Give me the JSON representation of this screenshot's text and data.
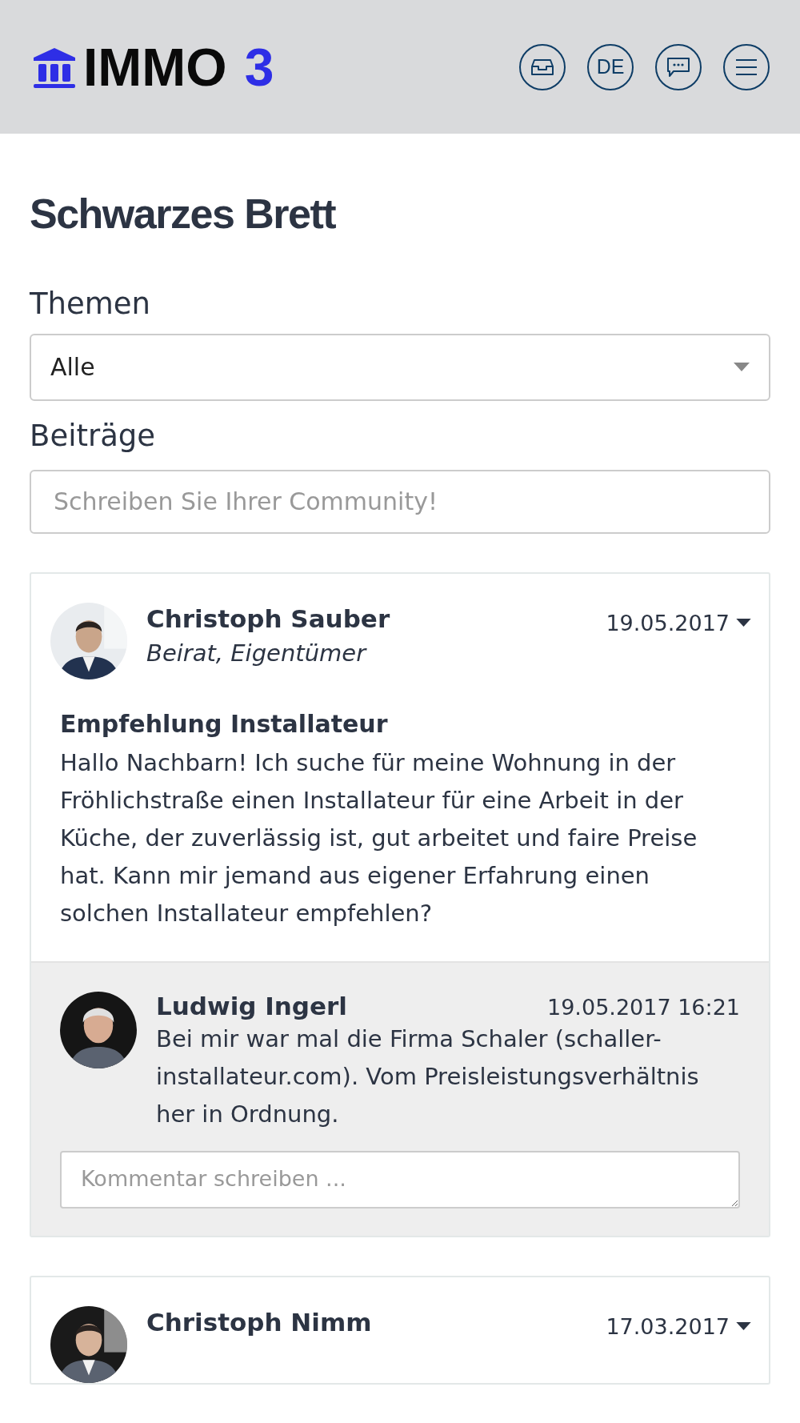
{
  "header": {
    "logo": {
      "name": "IMMO",
      "number": "3"
    },
    "actions": [
      {
        "kind": "inbox"
      },
      {
        "kind": "language",
        "label": "DE"
      },
      {
        "kind": "chat"
      },
      {
        "kind": "menu"
      }
    ]
  },
  "page_title": "Schwarzes Brett",
  "topics": {
    "label": "Themen",
    "value": "Alle"
  },
  "posts_section": {
    "label": "Beiträge",
    "placeholder": "Schreiben Sie Ihrer Community!"
  },
  "posts": [
    {
      "author": "Christoph Sauber",
      "roles": "Beirat, Eigentümer",
      "date": "19.05.2017",
      "title": "Empfehlung Installateur",
      "body": "Hallo Nachbarn! Ich suche für meine Wohnung in der Fröhlichstraße einen Installateur für eine Arbeit in der Küche, der zuverlässig ist, gut arbeitet und faire Preise hat. Kann mir jemand aus eigener Erfahrung einen solchen Installateur empfehlen?",
      "comments": [
        {
          "author": "Ludwig Ingerl",
          "time": "19.05.2017 16:21",
          "text": "Bei mir war mal die Firma Schaler (schaller-installateur.com). Vom Preisleistungsverhältnis her in Ordnung."
        }
      ],
      "comment_placeholder": "Kommentar schreiben ..."
    },
    {
      "author": "Christoph Nimm",
      "date": "17.03.2017"
    }
  ]
}
